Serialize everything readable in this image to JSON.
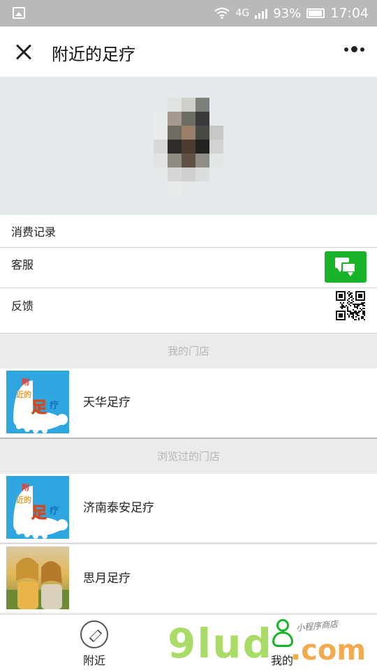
{
  "status_bar": {
    "network": "4G",
    "battery": "93%",
    "time": "17:04"
  },
  "nav": {
    "title": "附近的足疗"
  },
  "menu": {
    "records": "消费记录",
    "service": "客服",
    "feedback": "反馈"
  },
  "sections": {
    "my_stores": "我的门店",
    "browsed_stores": "浏览过的门店"
  },
  "my_stores": [
    {
      "name": "天华足疗"
    }
  ],
  "browsed_stores": [
    {
      "name": "济南泰安足疗"
    },
    {
      "name": "思月足疗"
    }
  ],
  "logo_text": {
    "line1": "附",
    "line2": "近的",
    "big": "足",
    "small": "疗"
  },
  "tabbar": {
    "nearby": "附近",
    "mine": "我的"
  },
  "watermark": {
    "main": "9lud",
    "com": ".com",
    "small": "小程序商店"
  },
  "icons": {
    "close": "close-icon",
    "more": "more-icon",
    "chat": "chat-icon",
    "qr": "qr-code-icon",
    "compass": "compass-icon",
    "person": "person-icon"
  },
  "colors": {
    "accent_green": "#19b32a",
    "logo_blue": "#2ea6e0",
    "section_text": "#b5b5b5"
  }
}
